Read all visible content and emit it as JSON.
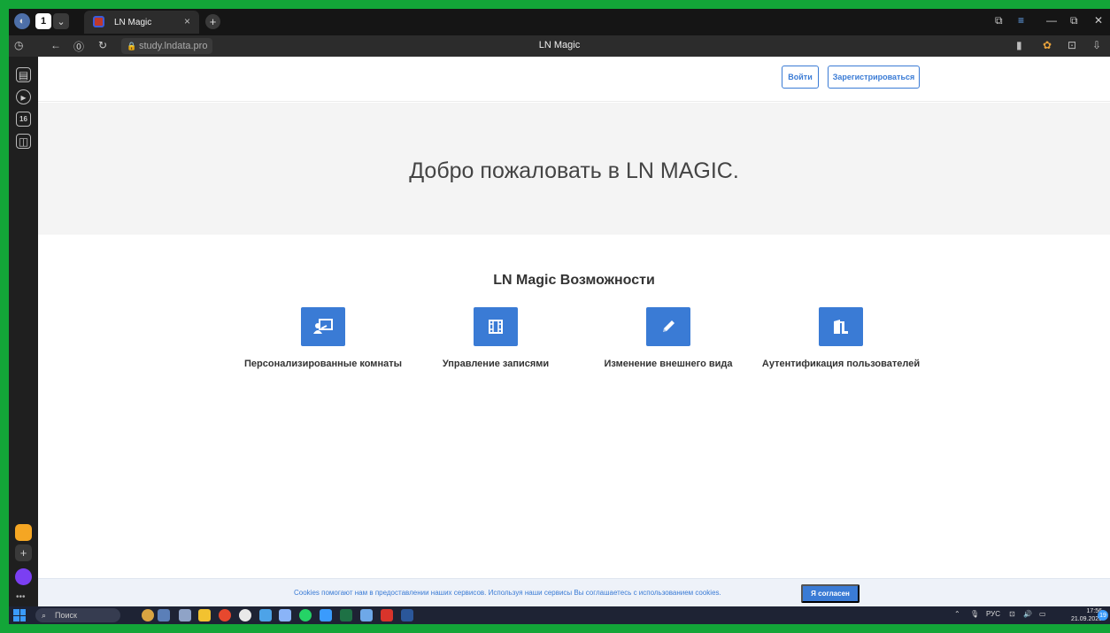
{
  "browser": {
    "tab": {
      "title": "LN Magic",
      "close_glyph": "×"
    },
    "new_tab_glyph": "+",
    "tab_counter": "1",
    "address": {
      "url": "study.lndata.pro",
      "page_title": "LN Magic"
    },
    "window_controls": [
      "⧉",
      "≡",
      "—",
      "⧉",
      "✕"
    ],
    "sidebar_badge": "16"
  },
  "page": {
    "login_label": "Войти",
    "register_label": "Зарегистрироваться",
    "hero_title": "Добро пожаловать в LN MAGIC.",
    "features_title": "LN Magic Возможности",
    "features": [
      {
        "label": "Персонализированные комнаты",
        "icon": "chalkboard-teacher-icon"
      },
      {
        "label": "Управление записями",
        "icon": "film-icon"
      },
      {
        "label": "Изменение внешнего вида",
        "icon": "pencil-icon"
      },
      {
        "label": "Аутентификация пользователей",
        "icon": "door-open-icon"
      }
    ],
    "cookie_text": "Cookies помогают нам в предоставлении наших сервисов. Используя наши сервисы Вы соглашаетесь с использованием cookies.",
    "cookie_button": "Я согласен",
    "accent_color": "#3a7bd5"
  },
  "taskbar": {
    "search_placeholder": "Поиск",
    "language": "РУС",
    "time": "17:56",
    "date": "21.09.2023",
    "notifications": "19"
  }
}
